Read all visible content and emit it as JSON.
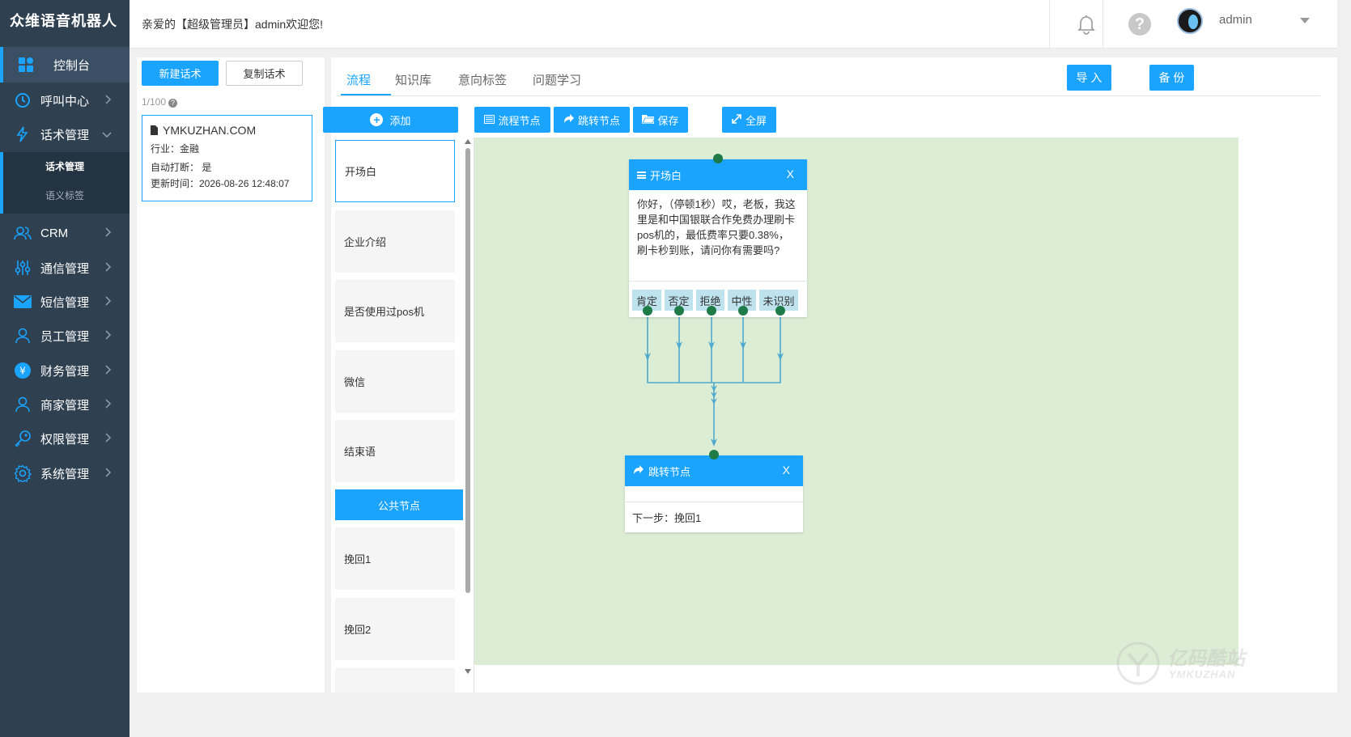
{
  "brand": "众维语音机器人",
  "header": {
    "welcome": "亲爱的【超级管理员】admin欢迎您!",
    "user": "admin"
  },
  "sidebar": {
    "items": [
      {
        "label": "控制台",
        "icon": "dashboard-icon"
      },
      {
        "label": "呼叫中心",
        "icon": "clock-icon"
      },
      {
        "label": "话术管理",
        "icon": "lightning-icon"
      },
      {
        "label": "CRM",
        "icon": "users-icon"
      },
      {
        "label": "通信管理",
        "icon": "sliders-icon"
      },
      {
        "label": "短信管理",
        "icon": "mail-icon"
      },
      {
        "label": "员工管理",
        "icon": "user-icon"
      },
      {
        "label": "财务管理",
        "icon": "yen-icon"
      },
      {
        "label": "商家管理",
        "icon": "user-icon"
      },
      {
        "label": "权限管理",
        "icon": "key-icon"
      },
      {
        "label": "系统管理",
        "icon": "gear-icon"
      }
    ],
    "submenu": [
      "话术管理",
      "语义标签"
    ]
  },
  "left_panel": {
    "new_script": "新建话术",
    "copy_script": "复制话术",
    "count": "1/100",
    "card": {
      "title": "YMKUZHAN.COM",
      "industry": "行业：金融",
      "auto_interrupt": "自动打断：  是",
      "updated": "更新时间：2026-08-26 12:48:07"
    }
  },
  "tabs": [
    "流程",
    "知识库",
    "意向标签",
    "问题学习"
  ],
  "actions": {
    "import": "导 入",
    "backup": "备 份",
    "add": "添加",
    "flow_node": "流程节点",
    "jump_node": "跳转节点",
    "save": "保存",
    "fullscreen": "全屏"
  },
  "node_list": {
    "items": [
      "开场白",
      "企业介绍",
      "是否使用过pos机",
      "微信",
      "结束语"
    ],
    "public_label": "公共节点",
    "public_items": [
      "挽回1",
      "挽回2"
    ]
  },
  "flow": {
    "opening": {
      "title": "开场白",
      "close": "X",
      "text": "你好，（停顿1秒）哎，老板，我这里是和中国银联合作免费办理刷卡pos机的，最低费率只要0.38%，刷卡秒到账，请问你有需要吗?",
      "branches": [
        "肯定",
        "否定",
        "拒绝",
        "中性",
        "未识别"
      ]
    },
    "jump": {
      "title": "跳转节点",
      "close": "X",
      "next": "下一步：挽回1"
    }
  },
  "colors": {
    "accent": "#1aa3ff",
    "sidebar": "#2f4050",
    "canvas": "#dcedd6",
    "dot": "#1e7a46"
  },
  "watermark": {
    "text": "亿码酷站",
    "sub": "YMKUZHAN"
  }
}
